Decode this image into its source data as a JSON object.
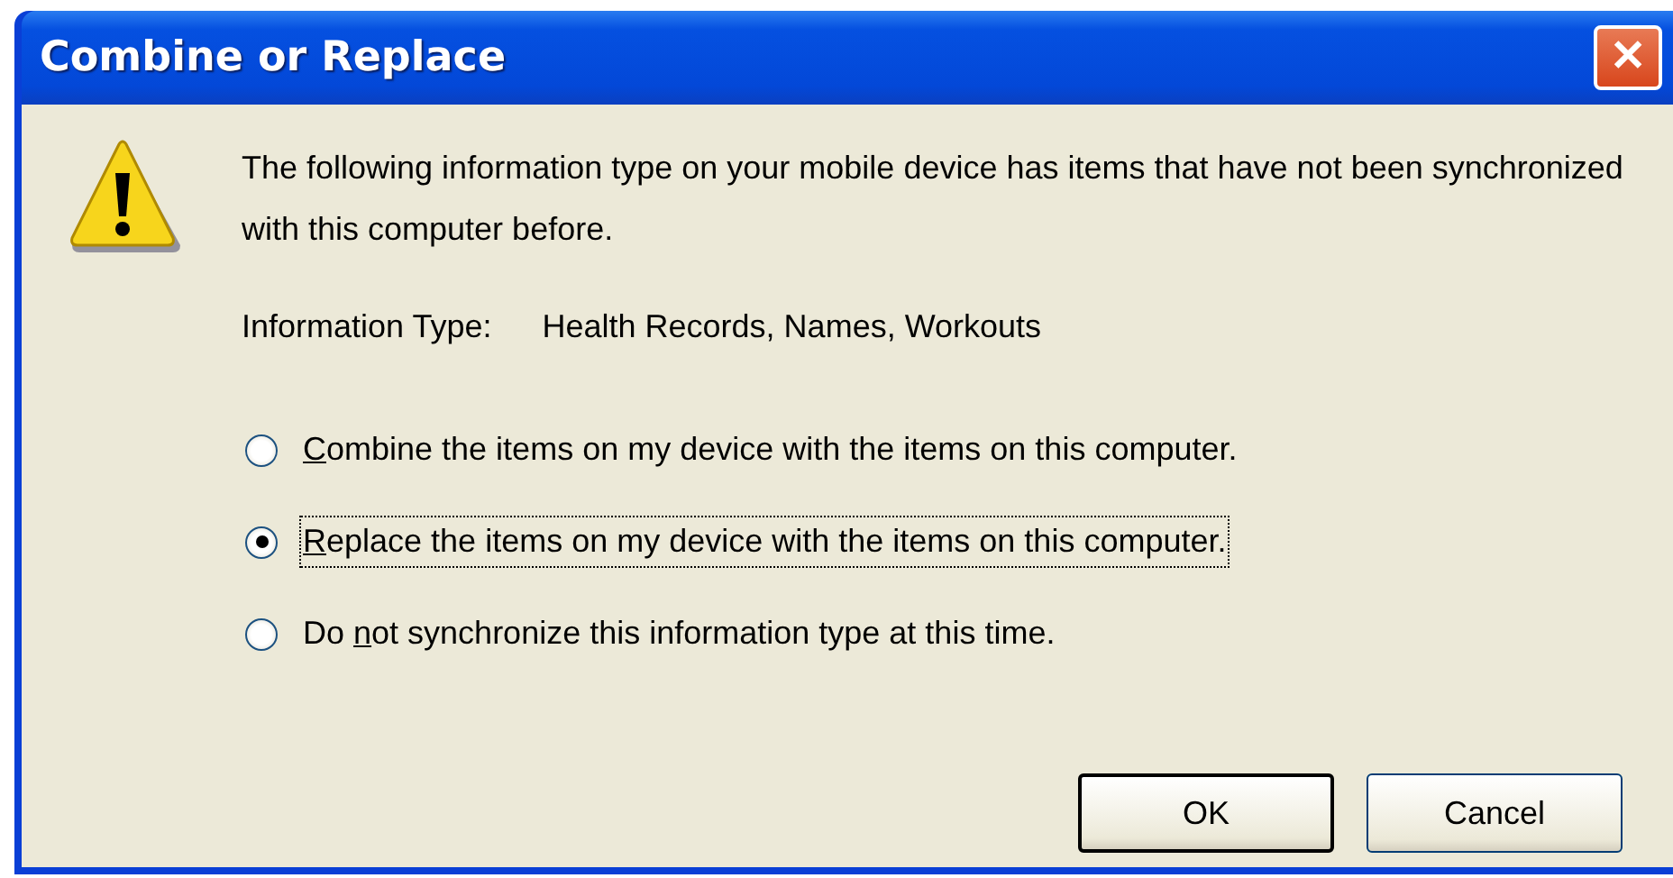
{
  "window": {
    "title": "Combine or Replace",
    "close": "✕"
  },
  "message": "The following information type on your mobile device has items that have not been synchronized with this computer before.",
  "information_type": {
    "label": "Information Type:",
    "value": "Health Records, Names, Workouts"
  },
  "options": [
    {
      "key": "C",
      "post": "ombine the items on my device with the items on this computer.",
      "selected": false
    },
    {
      "key": "R",
      "post": "eplace the items on my device with the items on this computer.",
      "selected": true
    },
    {
      "pre": "Do ",
      "key": "n",
      "post": "ot synchronize this information type at this time.",
      "selected": false
    }
  ],
  "buttons": [
    {
      "label": "OK",
      "default": true
    },
    {
      "label": "Cancel",
      "default": false
    }
  ]
}
